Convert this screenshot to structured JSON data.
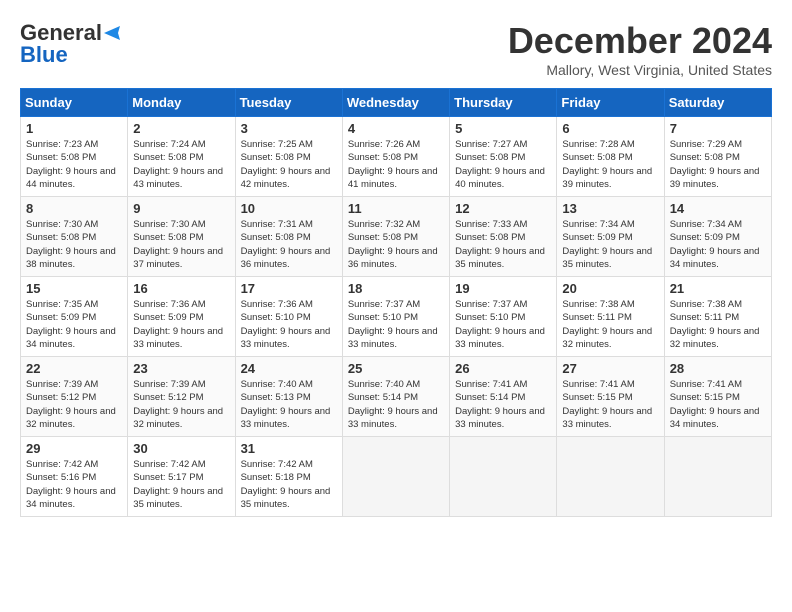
{
  "logo": {
    "line1": "General",
    "line2": "Blue"
  },
  "title": "December 2024",
  "location": "Mallory, West Virginia, United States",
  "days_header": [
    "Sunday",
    "Monday",
    "Tuesday",
    "Wednesday",
    "Thursday",
    "Friday",
    "Saturday"
  ],
  "weeks": [
    [
      {
        "day": "1",
        "sunrise": "7:23 AM",
        "sunset": "5:08 PM",
        "daylight": "9 hours and 44 minutes."
      },
      {
        "day": "2",
        "sunrise": "7:24 AM",
        "sunset": "5:08 PM",
        "daylight": "9 hours and 43 minutes."
      },
      {
        "day": "3",
        "sunrise": "7:25 AM",
        "sunset": "5:08 PM",
        "daylight": "9 hours and 42 minutes."
      },
      {
        "day": "4",
        "sunrise": "7:26 AM",
        "sunset": "5:08 PM",
        "daylight": "9 hours and 41 minutes."
      },
      {
        "day": "5",
        "sunrise": "7:27 AM",
        "sunset": "5:08 PM",
        "daylight": "9 hours and 40 minutes."
      },
      {
        "day": "6",
        "sunrise": "7:28 AM",
        "sunset": "5:08 PM",
        "daylight": "9 hours and 39 minutes."
      },
      {
        "day": "7",
        "sunrise": "7:29 AM",
        "sunset": "5:08 PM",
        "daylight": "9 hours and 39 minutes."
      }
    ],
    [
      {
        "day": "8",
        "sunrise": "7:30 AM",
        "sunset": "5:08 PM",
        "daylight": "9 hours and 38 minutes."
      },
      {
        "day": "9",
        "sunrise": "7:30 AM",
        "sunset": "5:08 PM",
        "daylight": "9 hours and 37 minutes."
      },
      {
        "day": "10",
        "sunrise": "7:31 AM",
        "sunset": "5:08 PM",
        "daylight": "9 hours and 36 minutes."
      },
      {
        "day": "11",
        "sunrise": "7:32 AM",
        "sunset": "5:08 PM",
        "daylight": "9 hours and 36 minutes."
      },
      {
        "day": "12",
        "sunrise": "7:33 AM",
        "sunset": "5:08 PM",
        "daylight": "9 hours and 35 minutes."
      },
      {
        "day": "13",
        "sunrise": "7:34 AM",
        "sunset": "5:09 PM",
        "daylight": "9 hours and 35 minutes."
      },
      {
        "day": "14",
        "sunrise": "7:34 AM",
        "sunset": "5:09 PM",
        "daylight": "9 hours and 34 minutes."
      }
    ],
    [
      {
        "day": "15",
        "sunrise": "7:35 AM",
        "sunset": "5:09 PM",
        "daylight": "9 hours and 34 minutes."
      },
      {
        "day": "16",
        "sunrise": "7:36 AM",
        "sunset": "5:09 PM",
        "daylight": "9 hours and 33 minutes."
      },
      {
        "day": "17",
        "sunrise": "7:36 AM",
        "sunset": "5:10 PM",
        "daylight": "9 hours and 33 minutes."
      },
      {
        "day": "18",
        "sunrise": "7:37 AM",
        "sunset": "5:10 PM",
        "daylight": "9 hours and 33 minutes."
      },
      {
        "day": "19",
        "sunrise": "7:37 AM",
        "sunset": "5:10 PM",
        "daylight": "9 hours and 33 minutes."
      },
      {
        "day": "20",
        "sunrise": "7:38 AM",
        "sunset": "5:11 PM",
        "daylight": "9 hours and 32 minutes."
      },
      {
        "day": "21",
        "sunrise": "7:38 AM",
        "sunset": "5:11 PM",
        "daylight": "9 hours and 32 minutes."
      }
    ],
    [
      {
        "day": "22",
        "sunrise": "7:39 AM",
        "sunset": "5:12 PM",
        "daylight": "9 hours and 32 minutes."
      },
      {
        "day": "23",
        "sunrise": "7:39 AM",
        "sunset": "5:12 PM",
        "daylight": "9 hours and 32 minutes."
      },
      {
        "day": "24",
        "sunrise": "7:40 AM",
        "sunset": "5:13 PM",
        "daylight": "9 hours and 33 minutes."
      },
      {
        "day": "25",
        "sunrise": "7:40 AM",
        "sunset": "5:14 PM",
        "daylight": "9 hours and 33 minutes."
      },
      {
        "day": "26",
        "sunrise": "7:41 AM",
        "sunset": "5:14 PM",
        "daylight": "9 hours and 33 minutes."
      },
      {
        "day": "27",
        "sunrise": "7:41 AM",
        "sunset": "5:15 PM",
        "daylight": "9 hours and 33 minutes."
      },
      {
        "day": "28",
        "sunrise": "7:41 AM",
        "sunset": "5:15 PM",
        "daylight": "9 hours and 34 minutes."
      }
    ],
    [
      {
        "day": "29",
        "sunrise": "7:42 AM",
        "sunset": "5:16 PM",
        "daylight": "9 hours and 34 minutes."
      },
      {
        "day": "30",
        "sunrise": "7:42 AM",
        "sunset": "5:17 PM",
        "daylight": "9 hours and 35 minutes."
      },
      {
        "day": "31",
        "sunrise": "7:42 AM",
        "sunset": "5:18 PM",
        "daylight": "9 hours and 35 minutes."
      },
      null,
      null,
      null,
      null
    ]
  ],
  "labels": {
    "sunrise": "Sunrise:",
    "sunset": "Sunset:",
    "daylight": "Daylight:"
  }
}
